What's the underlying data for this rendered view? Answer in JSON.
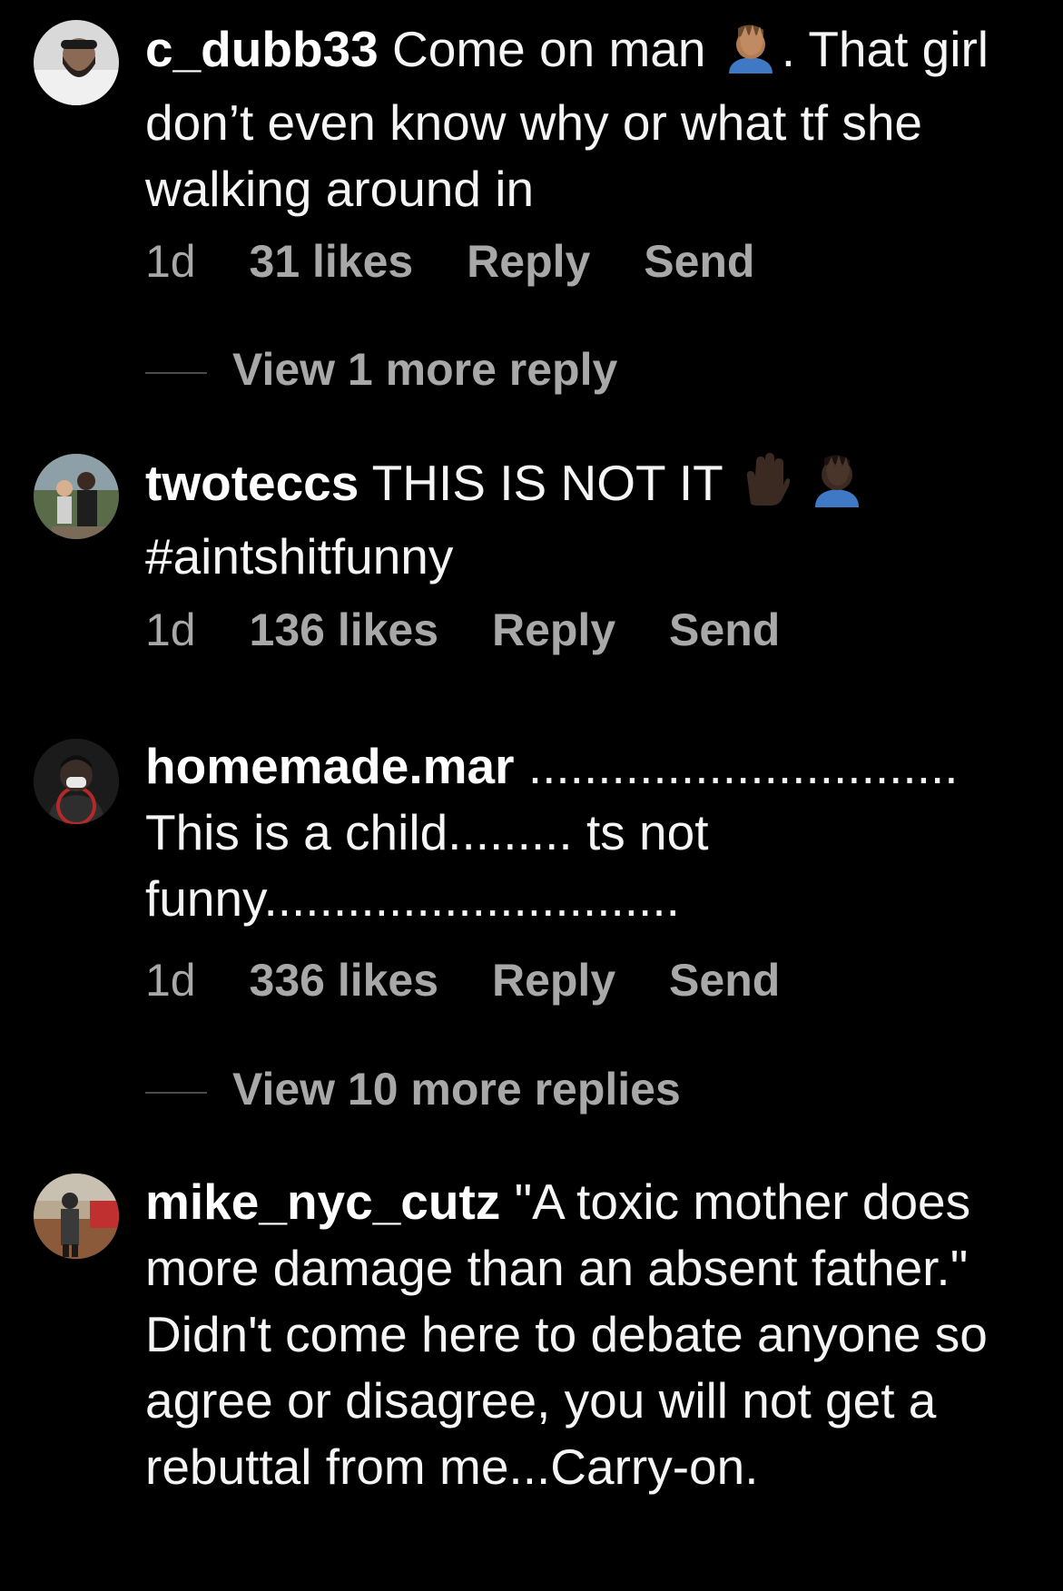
{
  "comments": [
    {
      "username": "c_dubb33",
      "text_before_emoji": "Come on man",
      "emoji_1": "facepalm-medium-skin",
      "text_after_emoji": ". That girl don’t even know why or what tf she walking around in",
      "time": "1d",
      "likes": "31 likes",
      "reply": "Reply",
      "send": "Send",
      "view_more": "View 1 more reply"
    },
    {
      "username": "twoteccs",
      "text_before_emoji": "THIS IS NOT IT",
      "emoji_1": "raised-hand-dark-skin",
      "emoji_2": "facepalm-dark-skin",
      "text_after_emoji": "#aintshitfunny",
      "time": "1d",
      "likes": "136 likes",
      "reply": "Reply",
      "send": "Send"
    },
    {
      "username": "homemade.mar",
      "text": "............................... This is a child......... ts not funny..............................",
      "time": "1d",
      "likes": "336 likes",
      "reply": "Reply",
      "send": "Send",
      "view_more": "View 10 more replies"
    },
    {
      "username": "mike_nyc_cutz",
      "text": "\"A toxic mother does more damage than an absent father.\" Didn't come here to debate anyone so agree or disagree, you will not get a rebuttal from me...Carry-on."
    }
  ],
  "colors": {
    "background": "#000000",
    "primary_text": "#f5f5f5",
    "secondary_text": "#a8a8a8",
    "divider": "#4a4a4a"
  }
}
